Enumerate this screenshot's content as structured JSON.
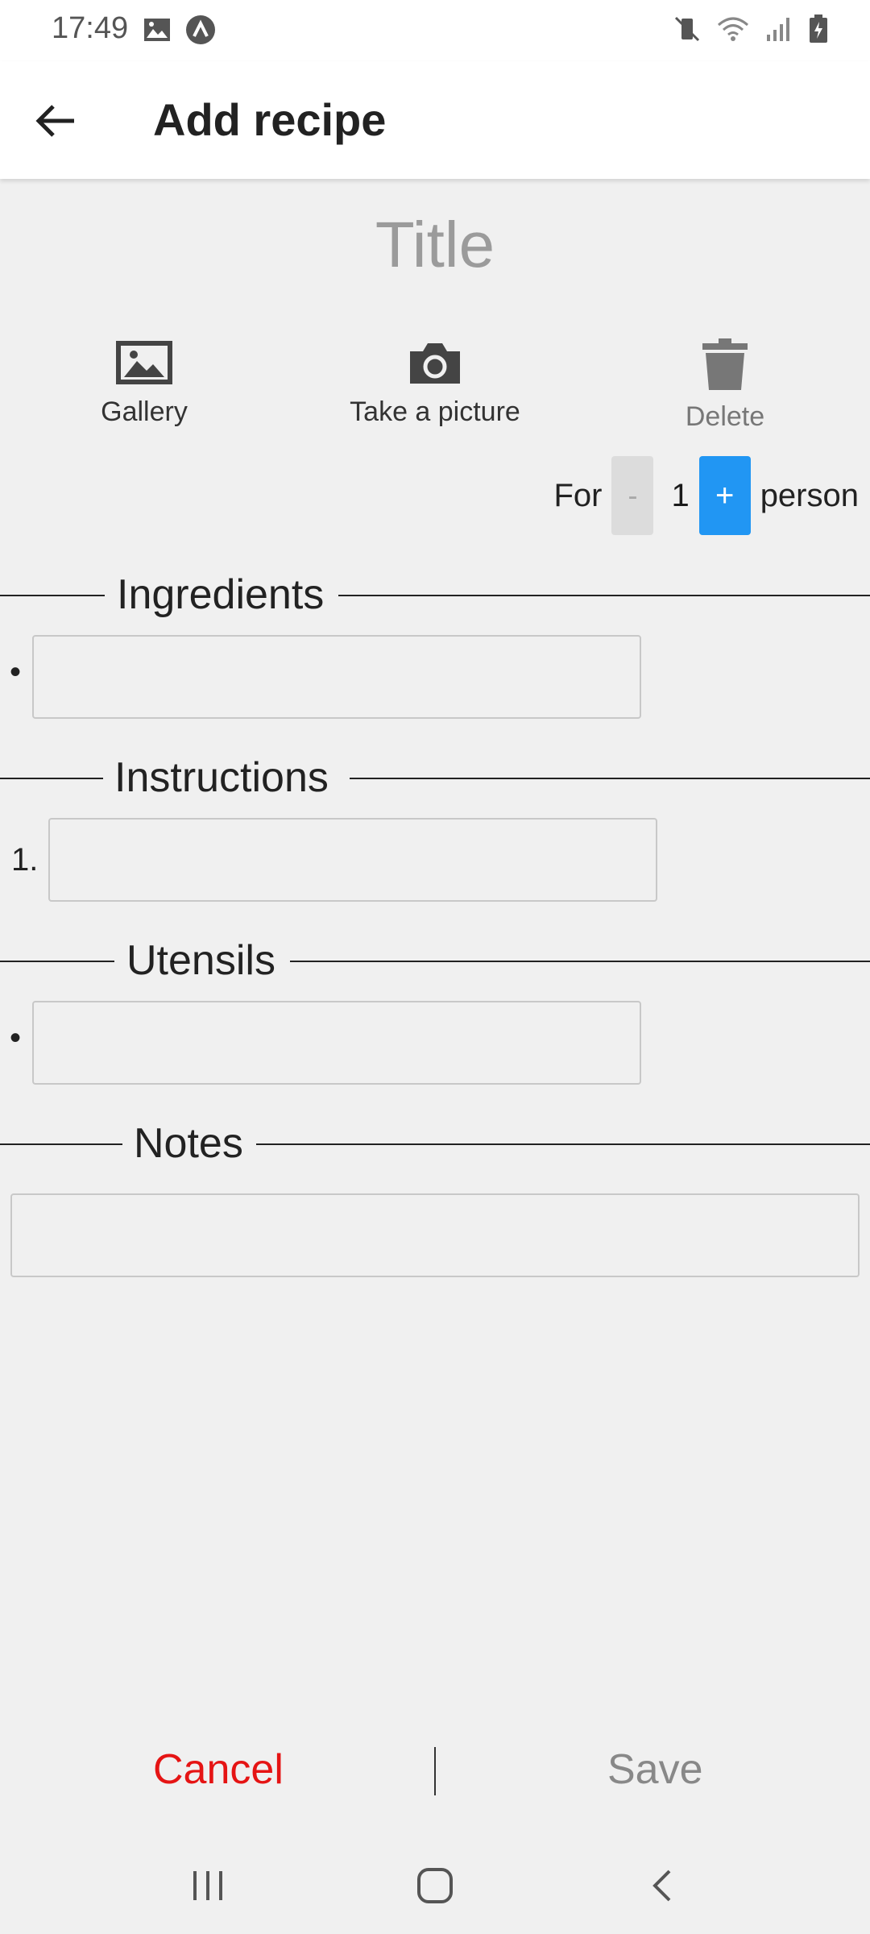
{
  "status_bar": {
    "time": "17:49",
    "left_icons": [
      "image-icon",
      "app-notification-icon"
    ],
    "right_icons": [
      "vibrate-mute-icon",
      "wifi-icon",
      "signal-icon",
      "battery-charging-icon"
    ]
  },
  "header": {
    "title": "Add recipe",
    "back_icon": "arrow-left-icon"
  },
  "recipe": {
    "title_placeholder": "Title"
  },
  "photo_actions": {
    "gallery": "Gallery",
    "take_picture": "Take a picture",
    "delete": "Delete"
  },
  "servings": {
    "prefix": "For",
    "minus": "-",
    "count": "1",
    "plus": "+",
    "suffix": "person"
  },
  "sections": {
    "ingredients": {
      "label": "Ingredients",
      "marker": "•",
      "value": ""
    },
    "instructions": {
      "label": "Instructions",
      "marker": "1.",
      "value": ""
    },
    "utensils": {
      "label": "Utensils",
      "marker": "•",
      "value": ""
    },
    "notes": {
      "label": "Notes",
      "value": ""
    }
  },
  "actions": {
    "cancel": "Cancel",
    "save": "Save"
  },
  "colors": {
    "cancel": "#e51414",
    "accent": "#2196f3",
    "background": "#f0f0f0"
  }
}
